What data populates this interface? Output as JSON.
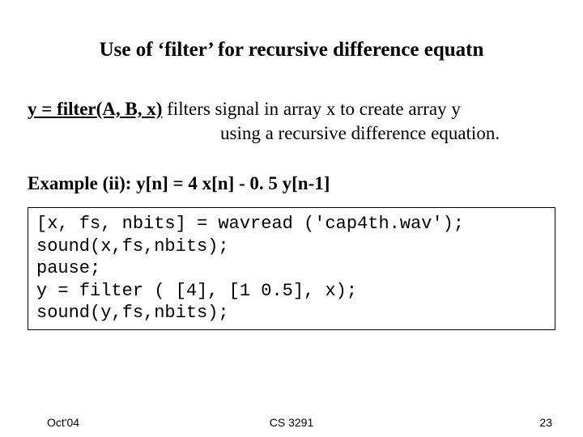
{
  "title": "Use of  ‘filter’ for recursive difference equatn",
  "desc": {
    "call": "y = filter(A, B, x)",
    "line1_rest": "  filters signal in array x to create array y",
    "line2": "using a recursive difference equation."
  },
  "example": {
    "label": "Example (ii):   ",
    "equation": "y[n]  = 4 x[n]  -  0. 5 y[n-1]"
  },
  "code": "[x, fs, nbits] = wavread ('cap4th.wav');\nsound(x,fs,nbits);\npause;\ny = filter ( [4], [1 0.5], x);\nsound(y,fs,nbits);",
  "footer": {
    "left": "Oct'04",
    "center": "CS 3291",
    "right": "23"
  }
}
